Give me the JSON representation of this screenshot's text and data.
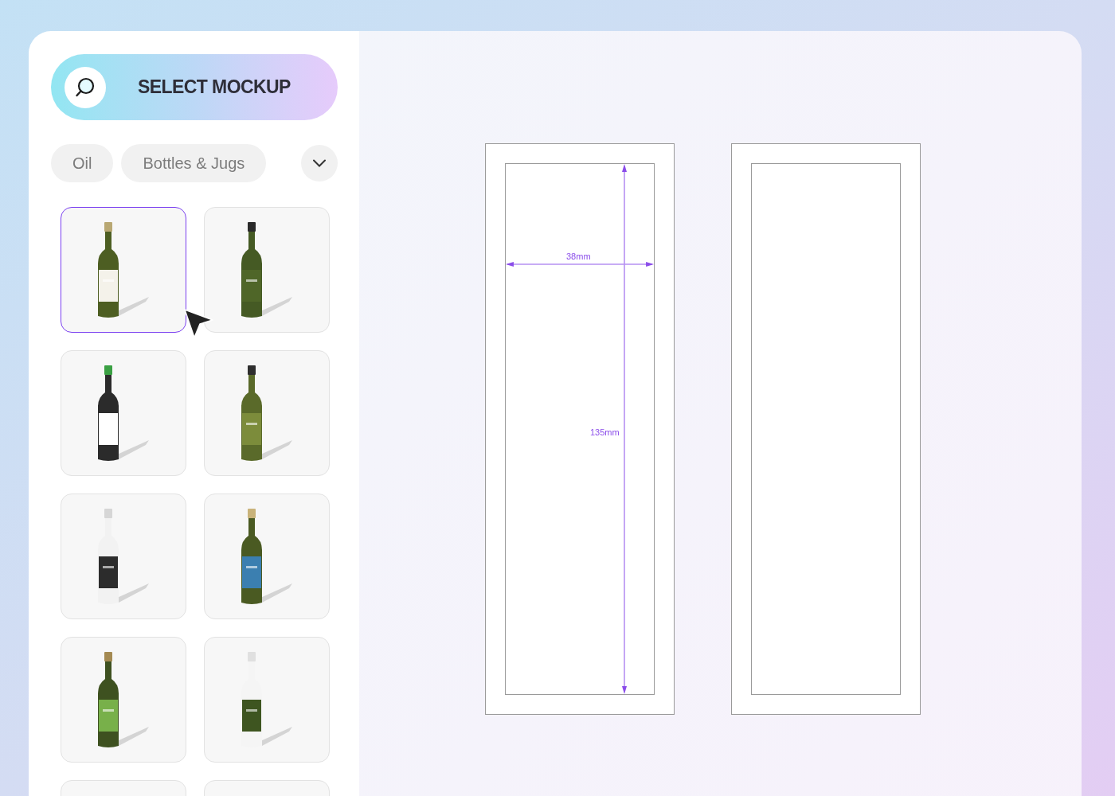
{
  "header": {
    "title": "SELECT MOCKUP"
  },
  "filters": [
    {
      "label": "Oil"
    },
    {
      "label": "Bottles & Jugs"
    }
  ],
  "mockups": [
    {
      "selected": true
    },
    {
      "selected": false
    },
    {
      "selected": false
    },
    {
      "selected": false
    },
    {
      "selected": false
    },
    {
      "selected": false
    },
    {
      "selected": false
    },
    {
      "selected": false
    },
    {
      "selected": false
    },
    {
      "selected": false
    }
  ],
  "dielines": [
    {
      "kind": "measured",
      "width_label": "38mm",
      "height_label": "135mm"
    },
    {
      "kind": "blank"
    }
  ]
}
